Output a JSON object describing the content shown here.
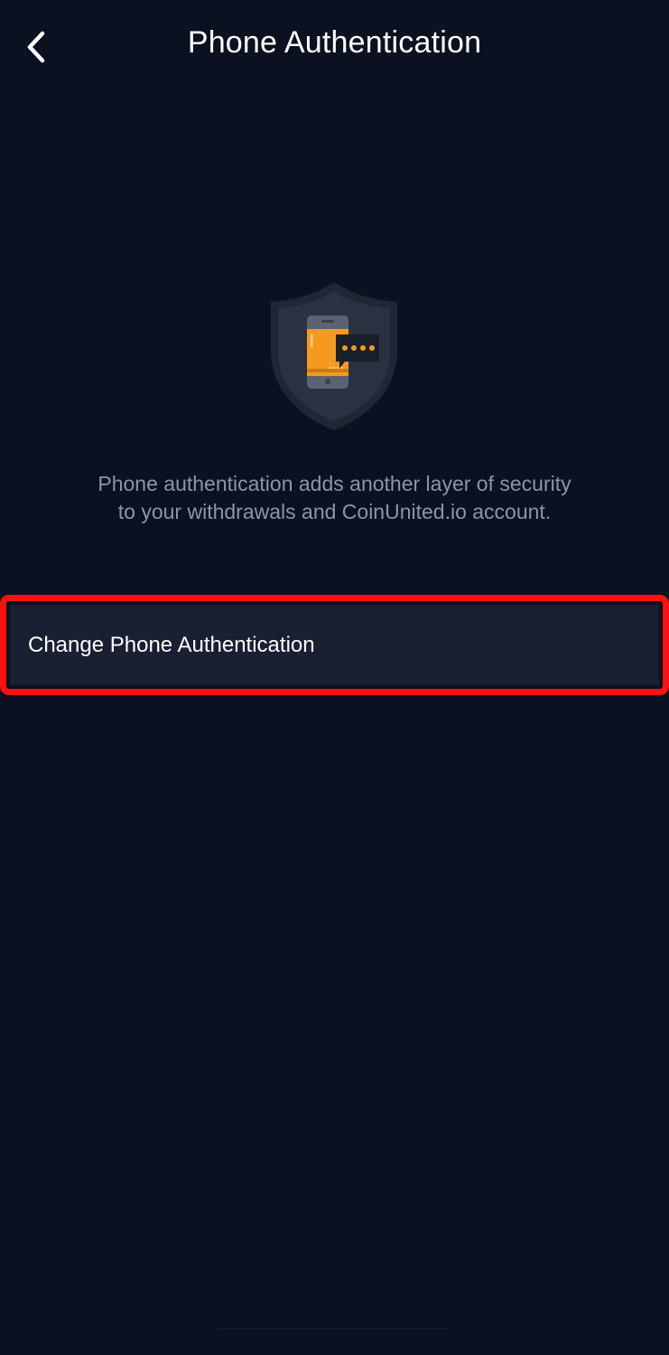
{
  "header": {
    "title": "Phone Authentication",
    "back_icon": "chevron-left-icon"
  },
  "hero": {
    "icon": "shield-phone-message-icon",
    "colors": {
      "shield_outer": "#1f2735",
      "shield_inner": "#2a3140",
      "phone": "#f59a1f",
      "bubble": "#1a202b",
      "dots": "#f59a1f"
    }
  },
  "description": {
    "line1": "Phone authentication adds another layer of security",
    "line2": "to your withdrawals and CoinUnited.io account."
  },
  "menu": {
    "items": [
      {
        "label": "Change Phone Authentication",
        "highlighted": true
      }
    ]
  },
  "colors": {
    "background": "#0a1120",
    "card": "#182032",
    "text_primary": "#ffffff",
    "text_secondary": "#8d95a3",
    "highlight": "#ff1010"
  }
}
